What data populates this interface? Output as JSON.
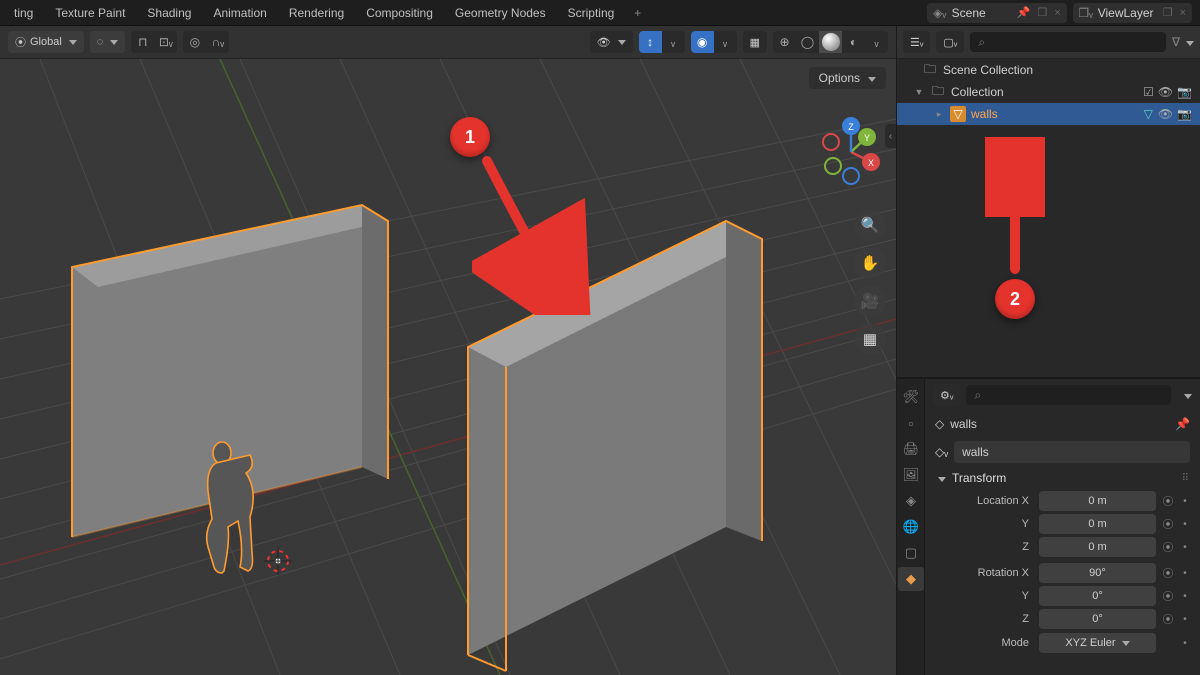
{
  "menu": {
    "items": [
      "ting",
      "Texture Paint",
      "Shading",
      "Animation",
      "Rendering",
      "Compositing",
      "Geometry Nodes",
      "Scripting"
    ]
  },
  "top": {
    "scene_label": "Scene",
    "viewlayer_label": "ViewLayer"
  },
  "vp_header": {
    "orientation": "Global",
    "options_label": "Options"
  },
  "outliner": {
    "root": "Scene Collection",
    "coll": "Collection",
    "walls": "walls"
  },
  "props": {
    "crumb": "walls",
    "name": "walls",
    "section": "Transform",
    "loc_label": "Location X",
    "rot_label": "Rotation X",
    "axis_y": "Y",
    "axis_z": "Z",
    "loc_x": "0 m",
    "loc_y": "0 m",
    "loc_z": "0 m",
    "rot_x": "90°",
    "rot_y": "0°",
    "rot_z": "0°",
    "mode_label": "Mode",
    "mode_value": "XYZ Euler"
  },
  "annot": {
    "n1": "1",
    "n2": "2"
  }
}
